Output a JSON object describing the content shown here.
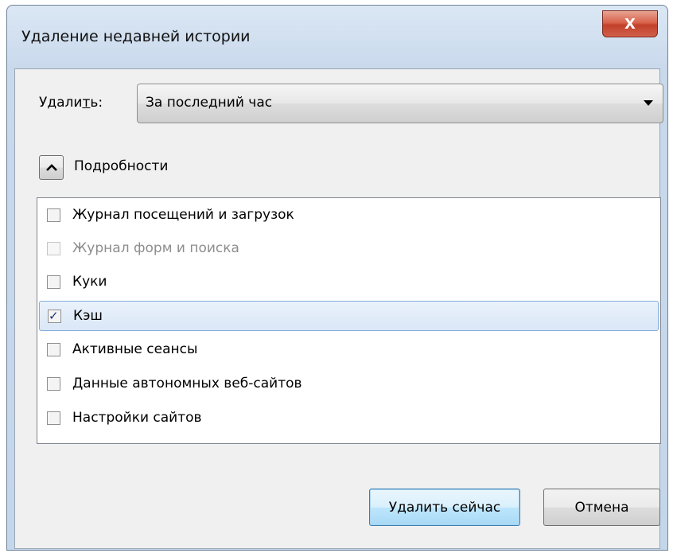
{
  "window": {
    "title": "Удаление недавней истории",
    "close_glyph": "X"
  },
  "time_range": {
    "label_prefix": "Удали",
    "label_accel": "т",
    "label_suffix": "ь:",
    "selected": "За последний час"
  },
  "details": {
    "label": "Подробности",
    "toggle_icon": "chevron-up-icon"
  },
  "items": [
    {
      "label": "Журнал посещений и загрузок",
      "checked": false,
      "disabled": false
    },
    {
      "label": "Журнал форм и поиска",
      "checked": false,
      "disabled": true
    },
    {
      "label": "Куки",
      "checked": false,
      "disabled": false
    },
    {
      "label": "Кэш",
      "checked": true,
      "disabled": false,
      "selected": true
    },
    {
      "label": "Активные сеансы",
      "checked": false,
      "disabled": false
    },
    {
      "label": "Данные автономных веб-сайтов",
      "checked": false,
      "disabled": false
    },
    {
      "label": "Настройки сайтов",
      "checked": false,
      "disabled": false
    }
  ],
  "buttons": {
    "clear_now": "Удалить сейчас",
    "cancel": "Отмена"
  },
  "colors": {
    "selection_fill": "#dae7f7",
    "selection_border": "#84acdd",
    "close_button": "#c2402a",
    "default_button": "#bee6fd"
  }
}
